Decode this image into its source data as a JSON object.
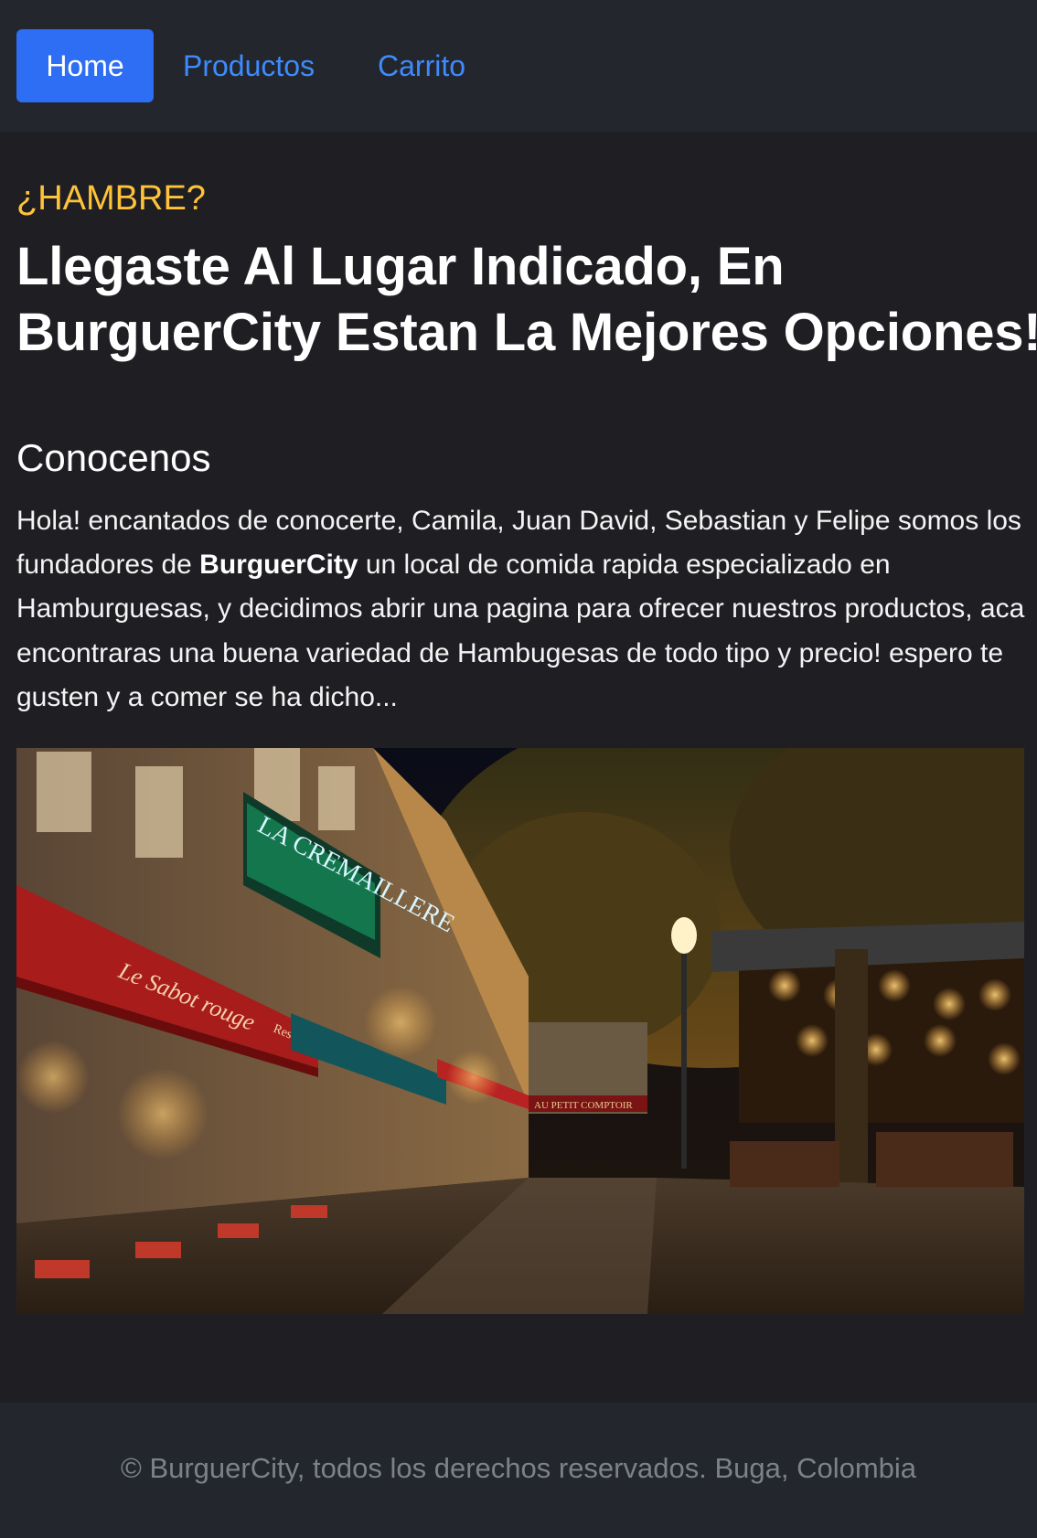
{
  "nav": {
    "items": [
      {
        "label": "Home"
      },
      {
        "label": "Productos"
      },
      {
        "label": "Carrito"
      }
    ]
  },
  "hero": {
    "eyebrow": "¿HAMBRE?",
    "headline_line1": "Llegaste Al Lugar Indicado, En",
    "headline_line2": "BurguerCity Estan La Mejores Opciones!"
  },
  "about": {
    "title": "Conocenos",
    "text_before": "Hola! encantados de conocerte, Camila, Juan David, Sebastian y Felipe somos los fundadores de ",
    "brand": "BurguerCity",
    "text_after": " un local de comida rapida especializado en Hamburguesas, y decidimos abrir una pagina para ofrecer nuestros productos, aca encontraras una buena variedad de Hambugesas de todo tipo y precio! espero te gusten y a comer se ha dicho..."
  },
  "image": {
    "sign_la_cremaillere": "LA CREMAILLERE",
    "sign_le_sabot": "Le Sabot rouge",
    "sign_restaurant": "Restaurant",
    "sign_petit_comptoir": "AU PETIT COMPTOIR"
  },
  "footer": {
    "text": "© BurguerCity, todos los derechos reservados. Buga, Colombia"
  },
  "colors": {
    "page_bg": "#1f1f23",
    "navbar_bg": "#23262d",
    "accent_blue": "#2d6ef5",
    "link_blue": "#3d8bfd",
    "eyebrow_yellow": "#ffc33a",
    "footer_text": "#7c828a"
  }
}
